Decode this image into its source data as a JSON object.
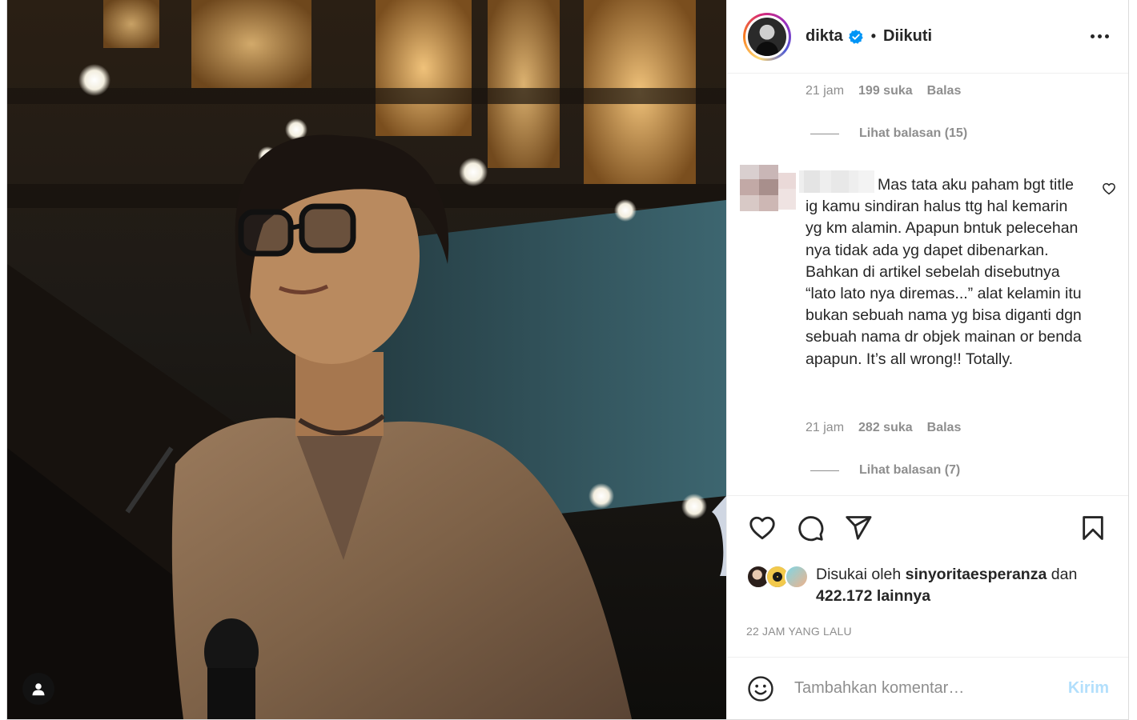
{
  "post": {
    "photo_alt": "",
    "tag_icon": "person-icon"
  },
  "header": {
    "username": "dikta",
    "verified_icon": "verified-badge-icon",
    "separator": "•",
    "follow_status": "Diikuti",
    "more_icon": "more-options-icon"
  },
  "thread": {
    "prev": {
      "time": "21 jam",
      "likes": "199 suka",
      "reply": "Balas",
      "view_replies": "Lihat balasan (15)"
    },
    "comment": {
      "username_redacted": true,
      "text": "Mas tata aku paham bgt title ig kamu sindiran halus ttg hal kemarin yg km alamin. Apapun bntuk pelecehan nya tidak ada yg dapet dibenarkan. Bahkan di artikel sebelah disebutnya “lato lato nya diremas...” alat kelamin itu bukan sebuah nama yg bisa diganti dgn sebuah nama dr objek mainan or benda apapun. It’s all wrong!! Totally.",
      "time": "21 jam",
      "likes": "282 suka",
      "reply": "Balas",
      "view_replies": "Lihat balasan (7)"
    }
  },
  "actions": {
    "like_icon": "heart-icon",
    "comment_icon": "comment-icon",
    "share_icon": "share-icon",
    "save_icon": "bookmark-icon"
  },
  "likes": {
    "prefix": "Disukai oleh",
    "user": "sinyoritaesperanza",
    "conj": "dan",
    "others": "422.172 lainnya"
  },
  "timestamp": "22 JAM YANG LALU",
  "composer": {
    "emoji_icon": "emoji-icon",
    "placeholder": "Tambahkan komentar…",
    "post_label": "Kirim"
  },
  "colors": {
    "accent_blue": "#0095f6",
    "post_disabled": "#b2dffc",
    "muted": "#8e8e8e",
    "border": "#dbdbdb"
  }
}
